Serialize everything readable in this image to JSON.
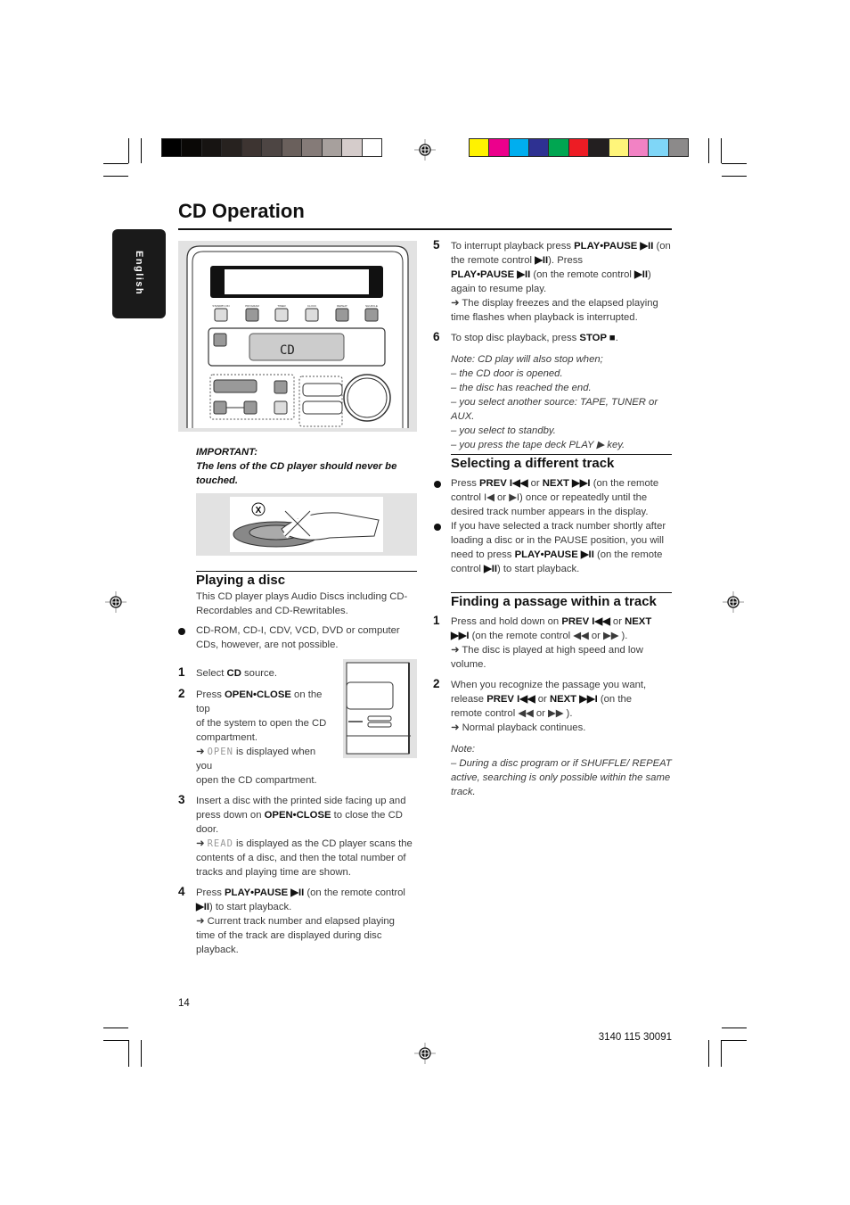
{
  "colors": {
    "gray_scale": [
      "#000000",
      "#0a0806",
      "#171412",
      "#27221f",
      "#3d3431",
      "#4d4543",
      "#6a605c",
      "#857b78",
      "#a7a09d",
      "#d5cccb",
      "#ffffff"
    ],
    "color_scale": [
      "#fff200",
      "#ec008c",
      "#00aeef",
      "#2e3192",
      "#00a651",
      "#ed1c24",
      "#231f20",
      "#fff57a",
      "#f282c4",
      "#7fd6f7",
      "#8c8a8a"
    ]
  },
  "header": {
    "title": "CD Operation",
    "language_tab": "English"
  },
  "figure_device": {
    "display_text": "CD",
    "labels": [
      "STANDBY-ON",
      "PROGRAM",
      "TIMER",
      "CLOCK",
      "REPEAT",
      "SHUFFLE"
    ]
  },
  "important": {
    "heading": "IMPORTANT:",
    "text": "The lens of the CD player should never be touched."
  },
  "left": {
    "playing_title": "Playing a disc",
    "intro": [
      {
        "t": "This CD player plays Audio Discs including CD-Recordables and CD-Rewritables."
      }
    ],
    "bullet": [
      {
        "t": "CD-ROM, CD-I, CDV, VCD, DVD or computer CDs, however, are not possible."
      }
    ],
    "steps": [
      {
        "n": "1",
        "rich": [
          {
            "t": "Select "
          },
          {
            "t": "CD",
            "s": "b"
          },
          {
            "t": " source."
          }
        ]
      },
      {
        "n": "2",
        "rich": [
          {
            "t": "Press "
          },
          {
            "t": "OPEN•CLOSE",
            "s": "b"
          },
          {
            "t": " on the\ntop\nof the system to open the CD\ncompartment.\n➜ "
          },
          {
            "t": "OPEN",
            "s": "lcd"
          },
          {
            "t": "  is displayed when\nyou\nopen the CD compartment."
          }
        ]
      },
      {
        "n": "3",
        "rich": [
          {
            "t": "Insert a disc with the printed side facing up and press down on "
          },
          {
            "t": "OPEN•CLOSE",
            "s": "b"
          },
          {
            "t": " to close the CD door.\n➜ "
          },
          {
            "t": "READ",
            "s": "lcd"
          },
          {
            "t": "  is displayed as the CD player scans the contents of a disc, and then the total number of tracks and playing time are shown."
          }
        ]
      },
      {
        "n": "4",
        "rich": [
          {
            "t": "Press "
          },
          {
            "t": "PLAY•PAUSE ▶II",
            "s": "b"
          },
          {
            "t": " (on the remote control "
          },
          {
            "t": "▶II",
            "s": "b"
          },
          {
            "t": ") to start playback.\n➜ Current track number and elapsed playing time of the track are displayed during disc playback."
          }
        ]
      }
    ]
  },
  "right": {
    "steps": [
      {
        "n": "5",
        "rich": [
          {
            "t": "To interrupt playback press "
          },
          {
            "t": "PLAY•PAUSE ▶II",
            "s": "b"
          },
          {
            "t": " (on the remote control "
          },
          {
            "t": "▶II",
            "s": "b"
          },
          {
            "t": "). Press\n"
          },
          {
            "t": "PLAY•PAUSE ▶II",
            "s": "b"
          },
          {
            "t": " (on the remote control "
          },
          {
            "t": "▶II",
            "s": "b"
          },
          {
            "t": ")\nagain to resume play.\n➜ The display freezes and the elapsed playing time flashes when playback is interrupted."
          }
        ]
      },
      {
        "n": "6",
        "rich": [
          {
            "t": "To stop disc playback, press "
          },
          {
            "t": "STOP ■",
            "s": "b"
          },
          {
            "t": "."
          }
        ]
      }
    ],
    "note": [
      {
        "t": "Note: CD play will also stop when;\n– the CD door is opened.\n– the disc has reached the end.\n– you select another source: TAPE, TUNER or AUX.\n– you select to standby.\n– you press the tape deck PLAY ▶ key.",
        "s": "i"
      }
    ],
    "selecting_title": "Selecting a different track",
    "selecting_bullets": [
      [
        {
          "t": "Press "
        },
        {
          "t": "PREV I◀◀",
          "s": "b"
        },
        {
          "t": " or "
        },
        {
          "t": "NEXT ▶▶I",
          "s": "b"
        },
        {
          "t": " (on the remote control I◀ or ▶I) once or repeatedly until the desired track number appears in the display."
        }
      ],
      [
        {
          "t": "If you have selected a track number shortly after loading a disc or in the PAUSE position, you will need to press "
        },
        {
          "t": "PLAY•PAUSE ▶II",
          "s": "b"
        },
        {
          "t": " (on the remote control "
        },
        {
          "t": "▶II",
          "s": "b"
        },
        {
          "t": ") to start playback."
        }
      ]
    ],
    "finding_title": "Finding a passage within a track",
    "finding_steps": [
      {
        "n": "1",
        "rich": [
          {
            "t": "Press and hold down on "
          },
          {
            "t": "PREV I◀◀",
            "s": "b"
          },
          {
            "t": " or "
          },
          {
            "t": "NEXT\n▶▶I",
            "s": "b"
          },
          {
            "t": " (on the remote control ◀◀ or ▶▶ ).\n➜ The disc is played at high speed and low volume."
          }
        ]
      },
      {
        "n": "2",
        "rich": [
          {
            "t": "When you recognize the passage you want, release "
          },
          {
            "t": "PREV I◀◀",
            "s": "b"
          },
          {
            "t": " or "
          },
          {
            "t": "NEXT ▶▶I",
            "s": "b"
          },
          {
            "t": " (on the remote control ◀◀ or ▶▶ ).\n➜ Normal playback continues."
          }
        ]
      }
    ],
    "finding_note": [
      {
        "t": "Note:\n–  During a disc program or if SHUFFLE/ REPEAT active, searching is only possible within the same track.",
        "s": "i"
      }
    ]
  },
  "footer": {
    "page_number": "14",
    "doc_code": "3140 115 30091"
  }
}
